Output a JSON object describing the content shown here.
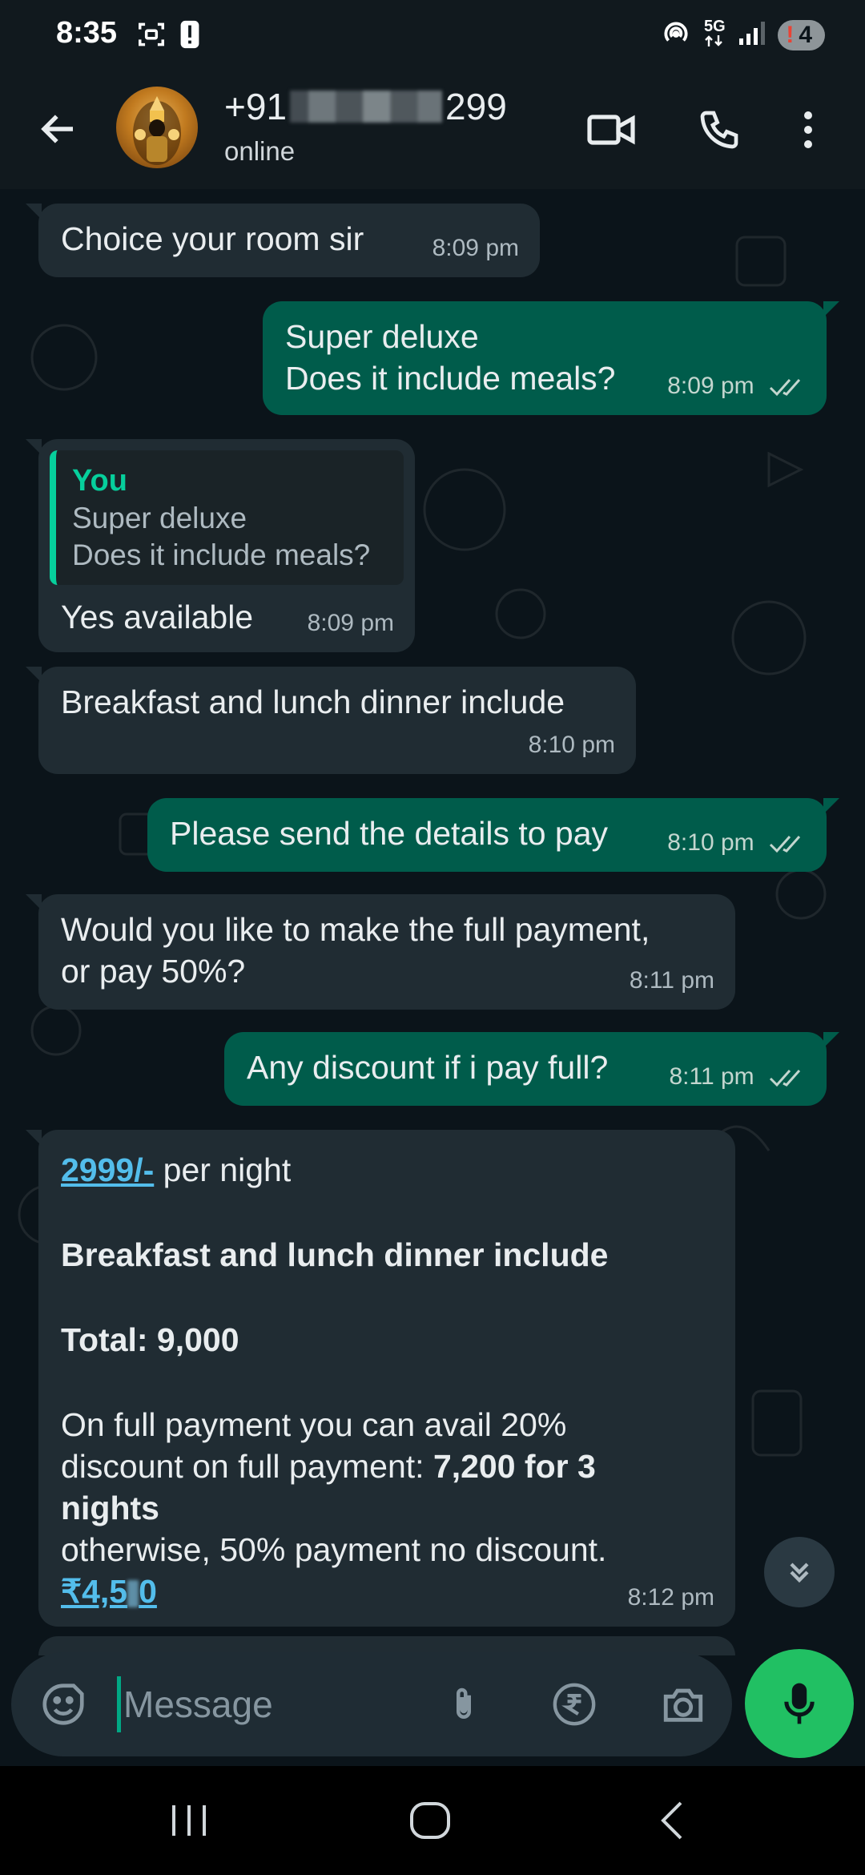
{
  "status_bar": {
    "time": "8:35",
    "network": "5G",
    "battery_level": "4"
  },
  "header": {
    "contact_prefix": "+91",
    "contact_suffix": "299",
    "status": "online"
  },
  "messages": [
    {
      "direction": "in",
      "text": "Choice your room sir",
      "time": "8:09 pm"
    },
    {
      "direction": "out",
      "lines": [
        "Super deluxe",
        "Does it include meals?"
      ],
      "time": "8:09 pm"
    },
    {
      "direction": "in",
      "quote_author": "You",
      "quote_lines": [
        "Super deluxe",
        "Does it include meals?"
      ],
      "text": "Yes available",
      "time": "8:09 pm"
    },
    {
      "direction": "in",
      "text": "Breakfast and lunch dinner include",
      "time": "8:10 pm"
    },
    {
      "direction": "out",
      "text": "Please send the details to pay",
      "time": "8:10 pm"
    },
    {
      "direction": "in",
      "lines": [
        "Would you like to make the full payment,",
        "or pay 50%?"
      ],
      "time": "8:11 pm"
    },
    {
      "direction": "out",
      "text": "Any discount if i pay full?",
      "time": "8:11 pm"
    },
    {
      "direction": "in",
      "price_link": "2999/-",
      "price_suffix": " per night",
      "meals_line": "Breakfast and lunch dinner include",
      "total_line": "Total: 9,000",
      "offer_line_1": "On full payment you can avail 20%",
      "offer_line_2_prefix": "discount on full payment: ",
      "offer_line_2_bold": "7,200 for 3",
      "offer_line_3_bold": "nights",
      "offer_line_4": "otherwise, 50% payment no discount.",
      "amount_link_prefix": "₹4,5",
      "amount_link_suffix": "0",
      "time": "8:12 pm"
    }
  ],
  "composer": {
    "placeholder": "Message"
  },
  "colors": {
    "incoming": "#202c33",
    "outgoing": "#005c4b",
    "accent": "#21c063",
    "link": "#53bdeb"
  }
}
